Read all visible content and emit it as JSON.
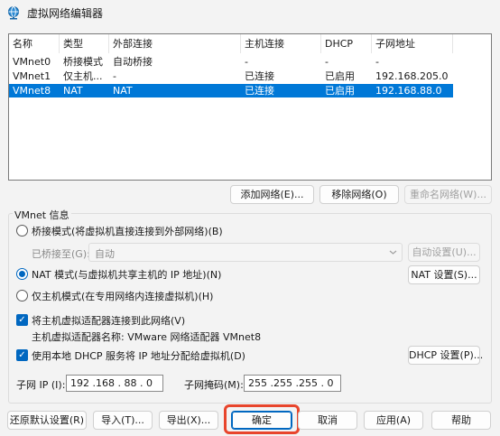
{
  "window": {
    "title": "虚拟网络编辑器",
    "icon": "network-globe-icon"
  },
  "table": {
    "headers": [
      "名称",
      "类型",
      "外部连接",
      "主机连接",
      "DHCP",
      "子网地址"
    ],
    "rows": [
      [
        "VMnet0",
        "桥接模式",
        "自动桥接",
        "-",
        "-",
        "-"
      ],
      [
        "VMnet1",
        "仅主机...",
        "-",
        "已连接",
        "已启用",
        "192.168.205.0"
      ],
      [
        "VMnet8",
        "NAT",
        "NAT",
        "已连接",
        "已启用",
        "192.168.88.0"
      ]
    ],
    "selected_row": 2
  },
  "list_buttons": {
    "add": "添加网络(E)...",
    "remove": "移除网络(O)",
    "rename": "重命名网络(W)..."
  },
  "vmnet_info": {
    "group_label": "VMnet 信息",
    "bridge_radio": "桥接模式(将虚拟机直接连接到外部网络)(B)",
    "bridged_to_label": "已桥接至(G):",
    "bridged_to_value": "自动",
    "auto_settings": "自动设置(U)...",
    "nat_radio": "NAT 模式(与虚拟机共享主机的 IP 地址)(N)",
    "nat_settings": "NAT 设置(S)...",
    "hostonly_radio": "仅主机模式(在专用网络内连接虚拟机)(H)",
    "selected_mode": "nat",
    "connect_adapter_check": "将主机虚拟适配器连接到此网络(V)",
    "adapter_name": "主机虚拟适配器名称: VMware 网络适配器 VMnet8",
    "dhcp_check": "使用本地 DHCP 服务将 IP 地址分配给虚拟机(D)",
    "dhcp_settings": "DHCP 设置(P)...",
    "subnet_ip_label": "子网 IP (I):",
    "subnet_ip": "192 .168 . 88 . 0",
    "subnet_mask_label": "子网掩码(M):",
    "subnet_mask": "255 .255 .255 . 0"
  },
  "bottom_buttons": {
    "restore": "还原默认设置(R)",
    "import": "导入(T)...",
    "export": "导出(X)...",
    "ok": "确定",
    "cancel": "取消",
    "apply": "应用(A)",
    "help": "帮助"
  }
}
